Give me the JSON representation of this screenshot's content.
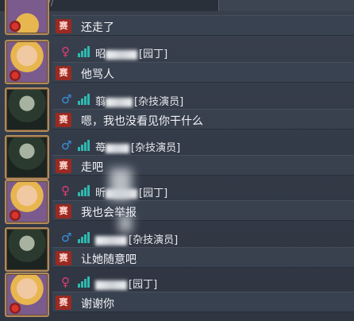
{
  "top_bar": {
    "mark": "//"
  },
  "messages": [
    {
      "avatar": "gardener",
      "avatar_icon": "gardener-portrait-icon",
      "has_header": false,
      "tag": "赛",
      "text": "还走了"
    },
    {
      "avatar": "gardener",
      "avatar_icon": "gardener-portrait-icon",
      "has_header": true,
      "gender": "♀",
      "gender_class": "female",
      "name_visible": "昭",
      "name_role": "[园丁]",
      "tag": "赛",
      "text": "他骂人"
    },
    {
      "avatar": "acrobat",
      "avatar_icon": "acrobat-portrait-icon",
      "has_header": true,
      "gender": "♂",
      "gender_class": "male",
      "name_visible": "翦",
      "name_role": "[杂技演员]",
      "tag": "赛",
      "text": "嗯，我也没看见你干什么"
    },
    {
      "avatar": "acrobat",
      "avatar_icon": "acrobat-portrait-icon",
      "has_header": true,
      "gender": "♂",
      "gender_class": "male",
      "name_visible": "苺",
      "name_role": "[杂技演员]",
      "tag": "赛",
      "text": "走吧"
    },
    {
      "avatar": "gardener",
      "avatar_icon": "gardener-portrait-icon",
      "has_header": true,
      "gender": "♀",
      "gender_class": "female",
      "name_visible": "昕",
      "name_role": "[园丁]",
      "tag": "赛",
      "text": "我也会举报"
    },
    {
      "avatar": "acrobat",
      "avatar_icon": "acrobat-portrait-icon",
      "has_header": true,
      "gender": "♂",
      "gender_class": "male",
      "name_visible": "",
      "name_role": "[杂技演员]",
      "tag": "赛",
      "text": "让她随意吧"
    },
    {
      "avatar": "gardener",
      "avatar_icon": "gardener-portrait-icon",
      "has_header": true,
      "gender": "♀",
      "gender_class": "female",
      "name_visible": "",
      "name_role": "[园丁]",
      "tag": "赛",
      "text": "谢谢你"
    }
  ]
}
